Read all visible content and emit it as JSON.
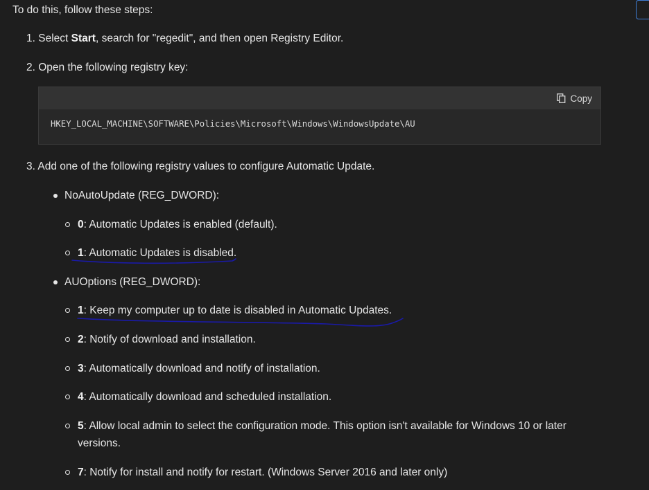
{
  "intro": "To do this, follow these steps:",
  "steps": [
    {
      "num": "1.",
      "pre": "Select ",
      "bold": "Start",
      "post": ", search for \"regedit\", and then open Registry Editor."
    },
    {
      "num": "2.",
      "text": "Open the following registry key:"
    },
    {
      "num": "3.",
      "text": "Add one of the following registry values to configure Automatic Update."
    }
  ],
  "code": {
    "copy_label": "Copy",
    "text": "HKEY_LOCAL_MACHINE\\SOFTWARE\\Policies\\Microsoft\\Windows\\WindowsUpdate\\AU"
  },
  "values": [
    {
      "label": "NoAutoUpdate (REG_DWORD):",
      "options": [
        {
          "key": "0",
          "desc": ": Automatic Updates is enabled (default)."
        },
        {
          "key": "1",
          "desc": ": Automatic Updates is disabled."
        }
      ]
    },
    {
      "label": "AUOptions (REG_DWORD):",
      "options": [
        {
          "key": "1",
          "desc": ": Keep my computer up to date is disabled in Automatic Updates."
        },
        {
          "key": "2",
          "desc": ": Notify of download and installation."
        },
        {
          "key": "3",
          "desc": ": Automatically download and notify of installation."
        },
        {
          "key": "4",
          "desc": ": Automatically download and scheduled installation."
        },
        {
          "key": "5",
          "desc": ": Allow local admin to select the configuration mode. This option isn't available for Windows 10 or later versions."
        },
        {
          "key": "7",
          "desc": ": Notify for install and notify for restart. (Windows Server 2016 and later only)"
        }
      ]
    }
  ],
  "colors": {
    "background": "#1e1e1e",
    "code_header": "#333333",
    "annotation": "#1a1aa8"
  }
}
